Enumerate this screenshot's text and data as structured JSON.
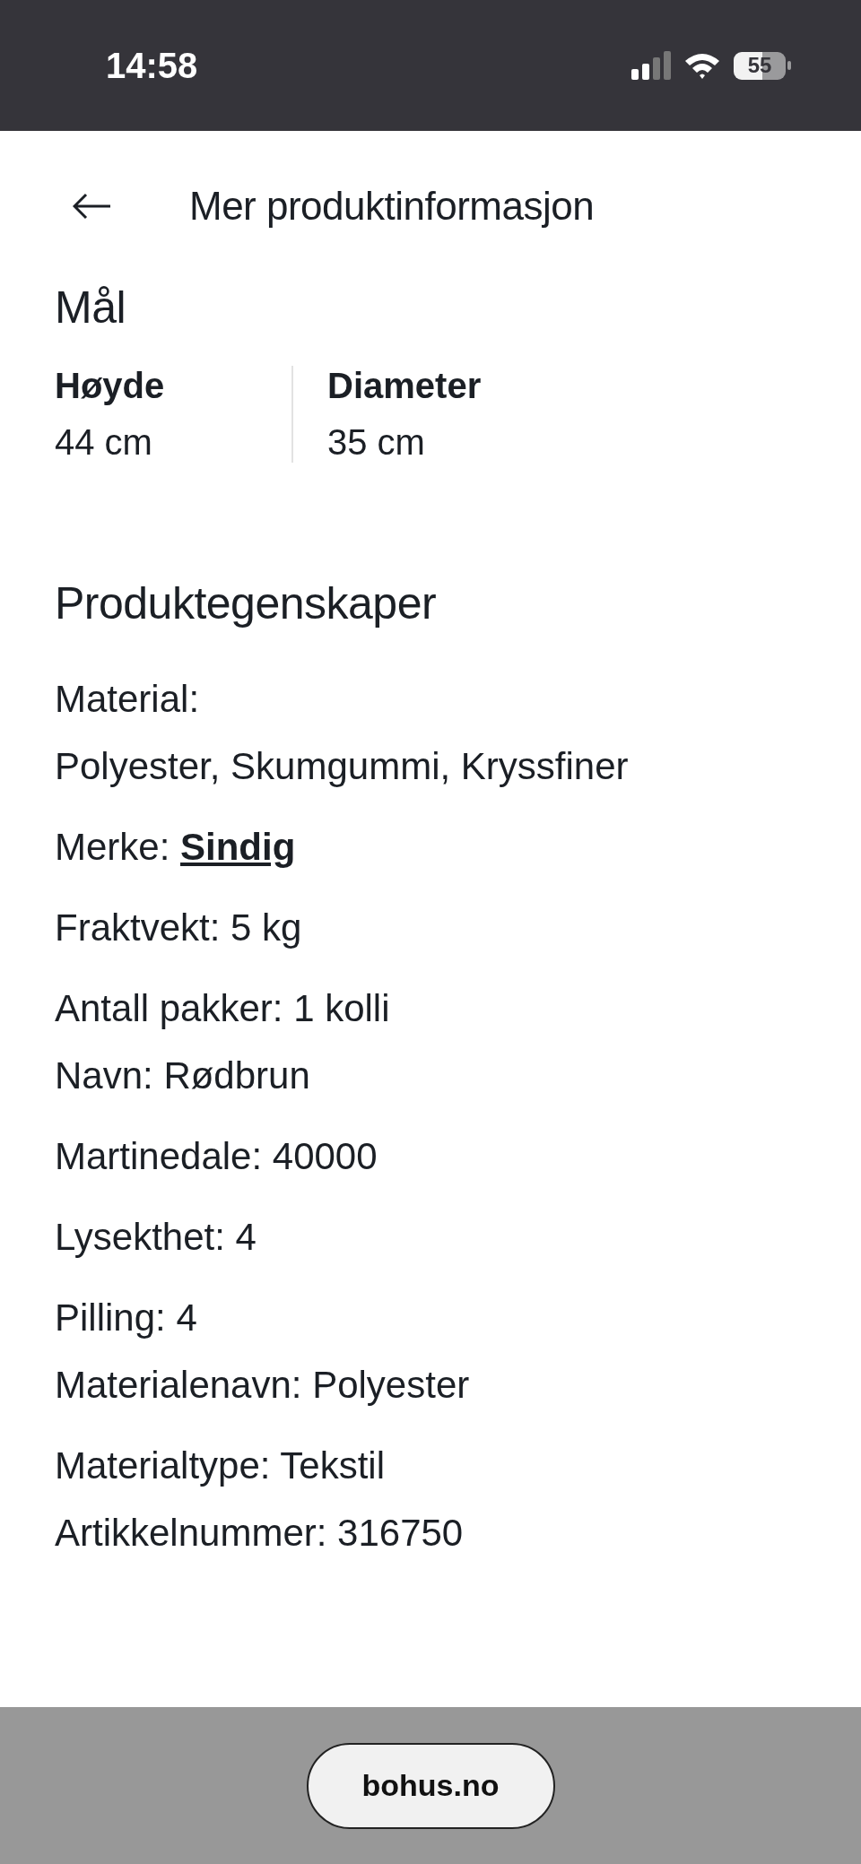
{
  "status_bar": {
    "time": "14:58",
    "battery": "55"
  },
  "header": {
    "title": "Mer produktinformasjon"
  },
  "dimensions": {
    "title": "Mål",
    "items": [
      {
        "label": "Høyde",
        "value": "44 cm"
      },
      {
        "label": "Diameter",
        "value": "35 cm"
      }
    ]
  },
  "properties": {
    "title": "Produktegenskaper",
    "groups": [
      {
        "lines": [
          {
            "text": "Material:"
          },
          {
            "text": "Polyester, Skumgummi, Kryssfiner"
          }
        ]
      },
      {
        "lines": [
          {
            "text": "Merke:",
            "link": "Sindig"
          }
        ]
      },
      {
        "lines": [
          {
            "text": "Fraktvekt: 5 kg"
          }
        ]
      },
      {
        "lines": [
          {
            "text": "Antall pakker: 1 kolli"
          },
          {
            "text": "Navn: Rødbrun"
          }
        ]
      },
      {
        "lines": [
          {
            "text": "Martinedale: 40000"
          }
        ]
      },
      {
        "lines": [
          {
            "text": "Lysekthet: 4"
          }
        ]
      },
      {
        "lines": [
          {
            "text": "Pilling: 4"
          },
          {
            "text": "Materialenavn: Polyester"
          }
        ]
      },
      {
        "lines": [
          {
            "text": "Materialtype: Tekstil"
          },
          {
            "text": "Artikkelnummer: 316750"
          }
        ]
      }
    ]
  },
  "browser_bar": {
    "url": "bohus.no"
  }
}
